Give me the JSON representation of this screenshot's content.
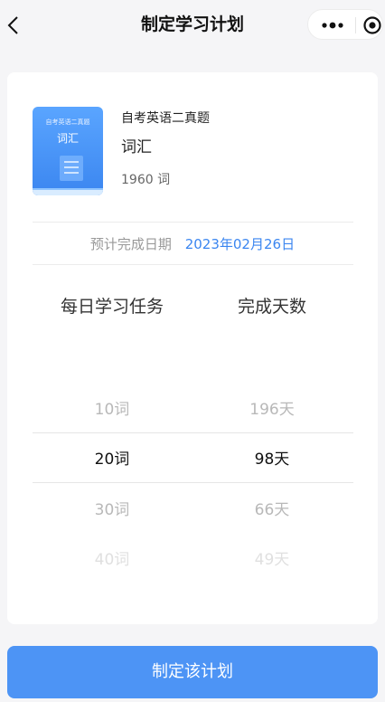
{
  "navbar": {
    "title": "制定学习计划",
    "icons": {
      "back": "chevron-left-icon",
      "more": "more-dots-icon",
      "close": "close-target-icon"
    }
  },
  "book": {
    "cover_top": "自考英语二真题",
    "cover_title": "词汇",
    "series": "自考英语二真题",
    "name": "词汇",
    "word_count": "1960 词"
  },
  "estimate": {
    "label": "预计完成日期",
    "date": "2023年02月26日"
  },
  "picker": {
    "left_header": "每日学习任务",
    "right_header": "完成天数",
    "rows": [
      {
        "words": "10词",
        "days": "196天",
        "state": "above"
      },
      {
        "words": "20词",
        "days": "98天",
        "state": "selected"
      },
      {
        "words": "30词",
        "days": "66天",
        "state": "below"
      },
      {
        "words": "40词",
        "days": "49天",
        "state": "below-far"
      }
    ]
  },
  "action": {
    "submit_label": "制定该计划"
  },
  "colors": {
    "accent": "#3b86f0",
    "button": "#4d94f5",
    "background": "#f5f5f7"
  }
}
